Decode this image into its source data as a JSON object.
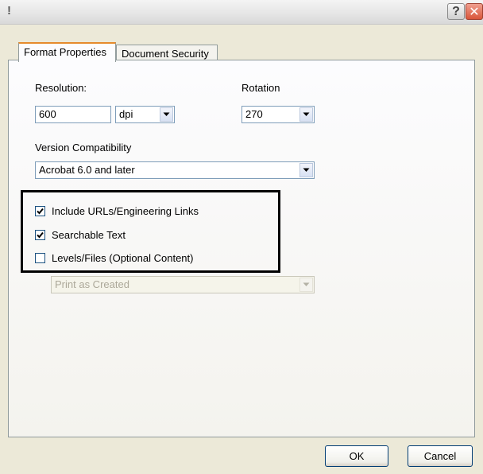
{
  "window": {
    "title": "!",
    "help_button": "?",
    "close_button": "✕"
  },
  "tabs": [
    {
      "label": "Format Properties",
      "active": true
    },
    {
      "label": "Document Security",
      "active": false
    }
  ],
  "resolution": {
    "label": "Resolution:",
    "value": "600",
    "unit": "dpi"
  },
  "rotation": {
    "label": "Rotation",
    "value": "270"
  },
  "version": {
    "label": "Version Compatibility",
    "value": "Acrobat 6.0 and later"
  },
  "options": [
    {
      "label": "Include URLs/Engineering Links",
      "checked": true
    },
    {
      "label": "Searchable Text",
      "checked": true
    },
    {
      "label": "Levels/Files (Optional Content)",
      "checked": false
    }
  ],
  "levels_dropdown": {
    "value": "Print as Created",
    "enabled": false
  },
  "buttons": {
    "ok": "OK",
    "cancel": "Cancel"
  }
}
